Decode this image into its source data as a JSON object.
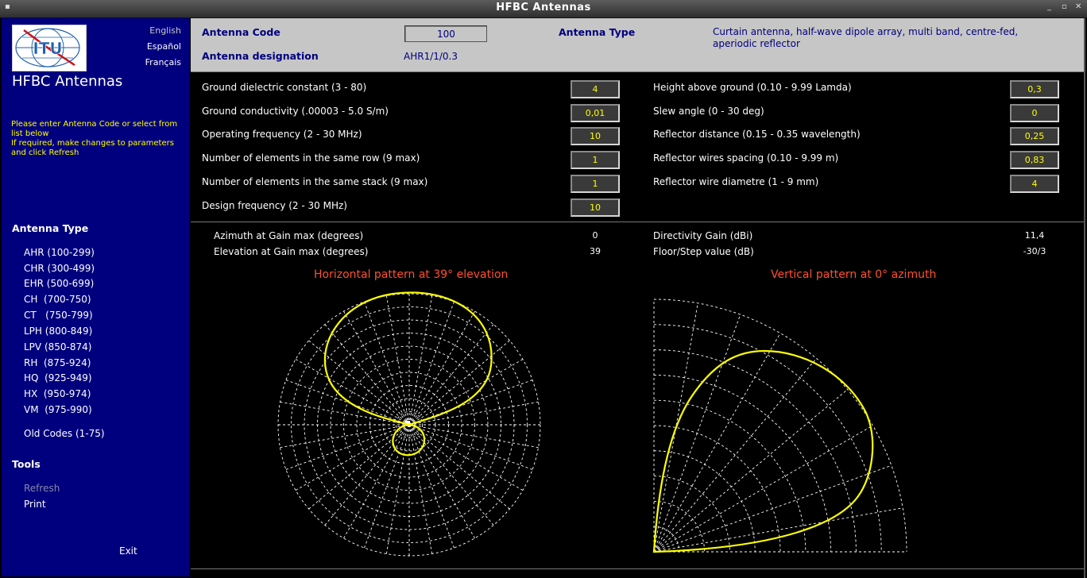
{
  "window": {
    "title": "HFBC Antennas",
    "controls": [
      "_",
      "▫",
      "✕"
    ]
  },
  "sidebar": {
    "logo_text": "ITU",
    "languages": [
      "English",
      "Español",
      "Français"
    ],
    "app_title": "HFBC Antennas",
    "instructions": "Please enter Antenna Code or select from list below\nIf required, make changes to parameters and click Refresh",
    "antenna_type_heading": "Antenna Type",
    "antenna_types": [
      "AHR (100-299)",
      "CHR (300-499)",
      "EHR (500-699)",
      "CH  (700-750)",
      "CT   (750-799)",
      "LPH (800-849)",
      "LPV (850-874)",
      "RH  (875-924)",
      "HQ  (925-949)",
      "HX  (950-974)",
      "VM  (975-990)"
    ],
    "old_codes": "Old Codes (1-75)",
    "tools_heading": "Tools",
    "tools": [
      "Refresh",
      "Print"
    ],
    "exit": "Exit"
  },
  "header": {
    "antenna_code_label": "Antenna Code",
    "antenna_code_value": "100",
    "antenna_designation_label": "Antenna designation",
    "antenna_designation_value": "AHR1/1/0.3",
    "antenna_type_label": "Antenna Type",
    "antenna_type_value": "Curtain antenna, half-wave dipole array, multi band, centre-fed, aperiodic reflector"
  },
  "params_left": [
    {
      "label": "Ground dielectric constant (3 - 80)",
      "value": "4"
    },
    {
      "label": "Ground conductivity (.00003 - 5.0 S/m)",
      "value": "0,01"
    },
    {
      "label": "Operating frequency (2 - 30 MHz)",
      "value": "10"
    },
    {
      "label": "Number of elements in the same row (9 max)",
      "value": "1"
    },
    {
      "label": "Number of elements in the same stack (9 max)",
      "value": "1"
    },
    {
      "label": "Design frequency (2 - 30 MHz)",
      "value": "10"
    }
  ],
  "params_right": [
    {
      "label": "Height above ground (0.10 - 9.99 Lamda)",
      "value": "0,3"
    },
    {
      "label": "Slew angle (0 - 30 deg)",
      "value": "0"
    },
    {
      "label": "Reflector distance (0.15 - 0.35 wavelength)",
      "value": "0,25"
    },
    {
      "label": "Reflector wires spacing (0.10 - 9.99 m)",
      "value": "0,83"
    },
    {
      "label": "Reflector wire diametre (1 - 9 mm)",
      "value": "4"
    }
  ],
  "results": {
    "azimuth_label": "Azimuth at Gain max (degrees)",
    "azimuth_value": "0",
    "elevation_label": "Elevation at Gain max (degrees)",
    "elevation_value": "39",
    "gain_label": "Directivity Gain (dBi)",
    "gain_value": "11,4",
    "floor_label": "Floor/Step value  (dB)",
    "floor_value": "-30/3"
  },
  "plots": {
    "horizontal_title": "Horizontal pattern at  39° elevation",
    "vertical_title": "Vertical pattern at  0° azimuth"
  },
  "colors": {
    "sidebar_bg": "#00007e",
    "header_bg": "#c6c6c6",
    "pattern": "#ffff00",
    "grid": "#ffffff",
    "plot_title": "#ff5030"
  }
}
